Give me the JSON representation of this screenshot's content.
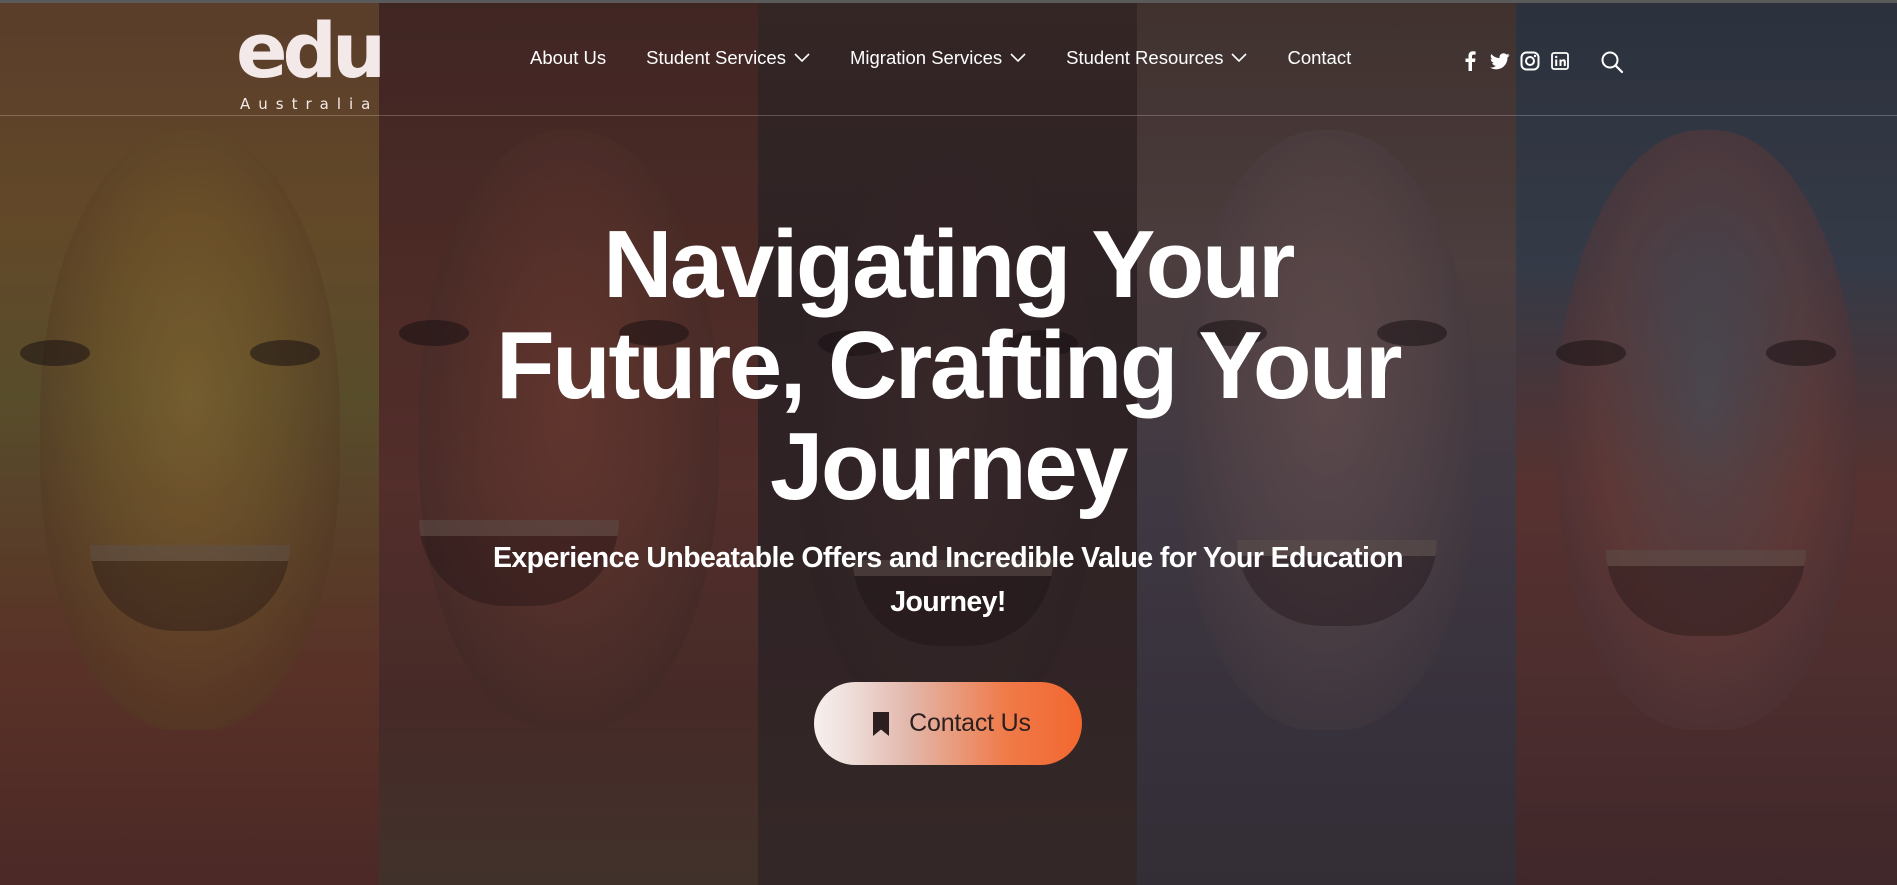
{
  "brand": {
    "logo_main": "edu",
    "logo_sub": "Australia"
  },
  "nav": {
    "items": [
      {
        "label": "About Us",
        "has_dropdown": false
      },
      {
        "label": "Student Services",
        "has_dropdown": true
      },
      {
        "label": "Migration Services",
        "has_dropdown": true
      },
      {
        "label": "Student Resources",
        "has_dropdown": true
      },
      {
        "label": "Contact",
        "has_dropdown": false
      }
    ]
  },
  "social": {
    "icons": [
      "facebook-icon",
      "twitter-icon",
      "instagram-icon",
      "linkedin-icon"
    ]
  },
  "search": {
    "icon": "search-icon"
  },
  "hero": {
    "title_lines": [
      "Navigating Your",
      "Future, Crafting Your",
      "Journey"
    ],
    "subtitle_lines": [
      "Experience Unbeatable Offers and Incredible Value for Your Education",
      "Journey!"
    ],
    "cta_label": "Contact Us",
    "cta_icon": "bookmark-icon"
  },
  "colors": {
    "cta_gradient_start": "#f7f0ee",
    "cta_gradient_end": "#f2672f",
    "text": "#ffffff"
  }
}
